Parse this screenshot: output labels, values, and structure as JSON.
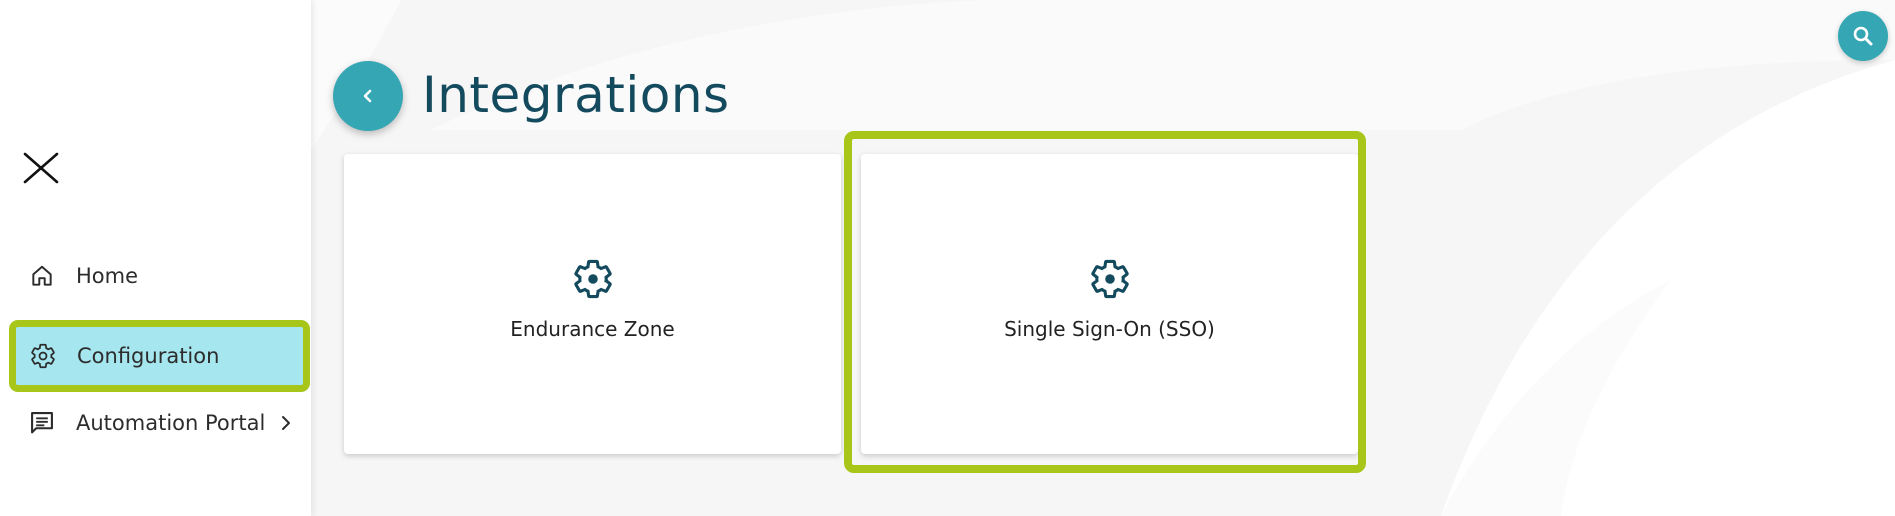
{
  "page": {
    "title": "Integrations"
  },
  "sidebar": {
    "close_icon": "close-icon",
    "items": [
      {
        "label": "Home",
        "icon": "home-icon"
      },
      {
        "label": "Configuration",
        "icon": "gear-icon",
        "selected": true
      },
      {
        "label": "Automation Portal",
        "icon": "chat-icon",
        "has_submenu": true
      }
    ]
  },
  "cards": [
    {
      "label": "Endurance Zone",
      "icon": "gear-icon"
    },
    {
      "label": "Single Sign-On (SSO)",
      "icon": "gear-icon",
      "highlighted": true
    }
  ],
  "colors": {
    "accent": "#35a7b4",
    "title": "#144a5e",
    "highlight": "#a8c619",
    "selected_bg": "#a6e6ef"
  },
  "icons": {
    "back": "chevron-left-icon",
    "search": "search-icon"
  }
}
